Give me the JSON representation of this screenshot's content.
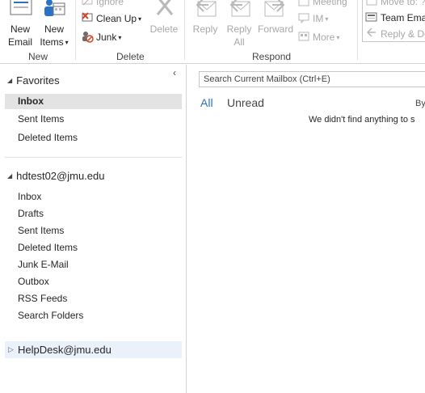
{
  "ribbon": {
    "new_group": {
      "label": "New",
      "new_email": "New\nEmail",
      "new_items": "New\nItems"
    },
    "delete_group": {
      "label": "Delete",
      "ignore": "Ignore",
      "clean_up": "Clean Up",
      "junk": "Junk",
      "delete": "Delete"
    },
    "respond_group": {
      "label": "Respond",
      "reply": "Reply",
      "reply_all": "Reply\nAll",
      "forward": "Forward",
      "meeting": "Meeting",
      "im": "IM",
      "more": "More"
    },
    "quick_steps": {
      "move_to": "Move to: ?",
      "team_email": "Team Emai",
      "reply_delete": "Reply & De"
    }
  },
  "nav": {
    "favorites": {
      "header": "Favorites",
      "items": [
        "Inbox",
        "Sent Items",
        "Deleted Items"
      ]
    },
    "account": {
      "header": "hdtest02@jmu.edu",
      "items": [
        "Inbox",
        "Drafts",
        "Sent Items",
        "Deleted Items",
        "Junk E-Mail",
        "Outbox",
        "RSS Feeds",
        "Search Folders"
      ]
    },
    "helpdesk": {
      "header": "HelpDesk@jmu.edu"
    }
  },
  "list": {
    "search_placeholder": "Search Current Mailbox (Ctrl+E)",
    "filter_all": "All",
    "filter_unread": "Unread",
    "by_label": "By",
    "empty_message": "We didn't find anything to s"
  },
  "colors": {
    "accent": "#2a72c4",
    "selected_bg": "#e3e3e3",
    "hover_bg": "#eaf1fb",
    "disabled_text": "#a8a8a8"
  }
}
